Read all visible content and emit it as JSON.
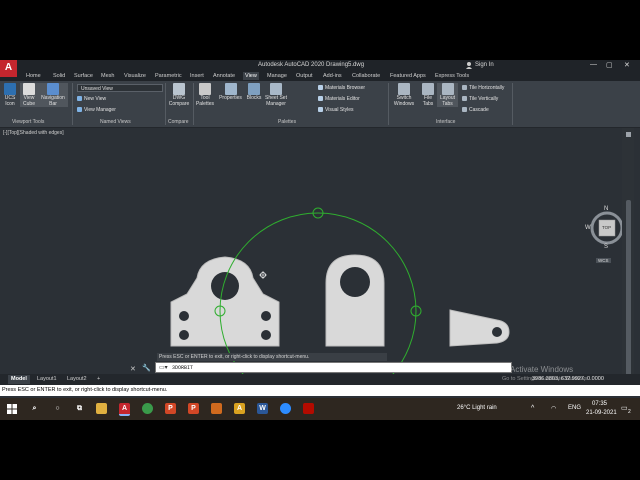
{
  "app": {
    "logo": "A",
    "title": "Autodesk AutoCAD 2020    Drawing5.dwg",
    "sign_in": "Sign In",
    "min": "—",
    "max": "▢",
    "close": "✕"
  },
  "ribbon_tabs": [
    "Home",
    "Solid",
    "Surface",
    "Mesh",
    "Visualize",
    "Parametric",
    "Insert",
    "Annotate",
    "View",
    "Manage",
    "Output",
    "Add-ins",
    "Collaborate",
    "Featured Apps",
    "Express Tools"
  ],
  "active_tab": "View",
  "ribbon": {
    "ucs_icon": "UCS\nIcon",
    "view_cube": "View\nCube",
    "nav_bar": "Navigation\nBar",
    "viewport_tools": "Viewport Tools",
    "view_dropdown": "Unsaved View",
    "new_view": "New View",
    "view_manager": "View Manager",
    "named_views": "Named Views",
    "dwg_compare": "DWG\nCompare",
    "compare": "Compare",
    "tool_palettes": "Tool\nPalettes",
    "properties": "Properties",
    "blocks": "Blocks",
    "sheet_set_manager": "Sheet Set\nManager",
    "materials_browser": "Materials Browser",
    "materials_editor": "Materials Editor",
    "visual_styles": "Visual Styles",
    "palettes": "Palettes",
    "switch_windows": "Switch\nWindows",
    "file_tabs": "File\nTabs",
    "layout_tabs": "Layout\nTabs",
    "tile_horizontally": "Tile Horizontally",
    "tile_vertically": "Tile Vertically",
    "cascade": "Cascade",
    "interface": "Interface"
  },
  "viewport": {
    "label": "[-][Top][Shaded with edges]",
    "compass": {
      "n": "N",
      "s": "S",
      "e": "E",
      "w": "W",
      "top": "TOP",
      "wcs": "WCS"
    }
  },
  "command": {
    "history": "Press ESC or ENTER to exit, or right-click to display shortcut-menu.",
    "input": "3DORBIT",
    "close": "✕",
    "wrench": "🔧"
  },
  "layout_tabs": [
    "Model",
    "Layout1",
    "Layout2"
  ],
  "add_layout": "+",
  "coordinates": "3986.3803, 632.9927, 0.0000",
  "watermark": {
    "line1": "Activate Windows",
    "line2": "Go to Settings to activate Windows."
  },
  "status_message": "Press ESC or ENTER to exit, or right-click to display shortcut-menu.",
  "taskbar": {
    "weather": "26°C  Light rain",
    "lang": "ENG",
    "time": "07:35",
    "date": "21-09-2021",
    "notification_count": "2"
  },
  "colors": {
    "accent_red": "#c4262e",
    "orbit_green": "#2fae2f",
    "part_fill": "#d9d9d9",
    "background": "#2b3036"
  }
}
